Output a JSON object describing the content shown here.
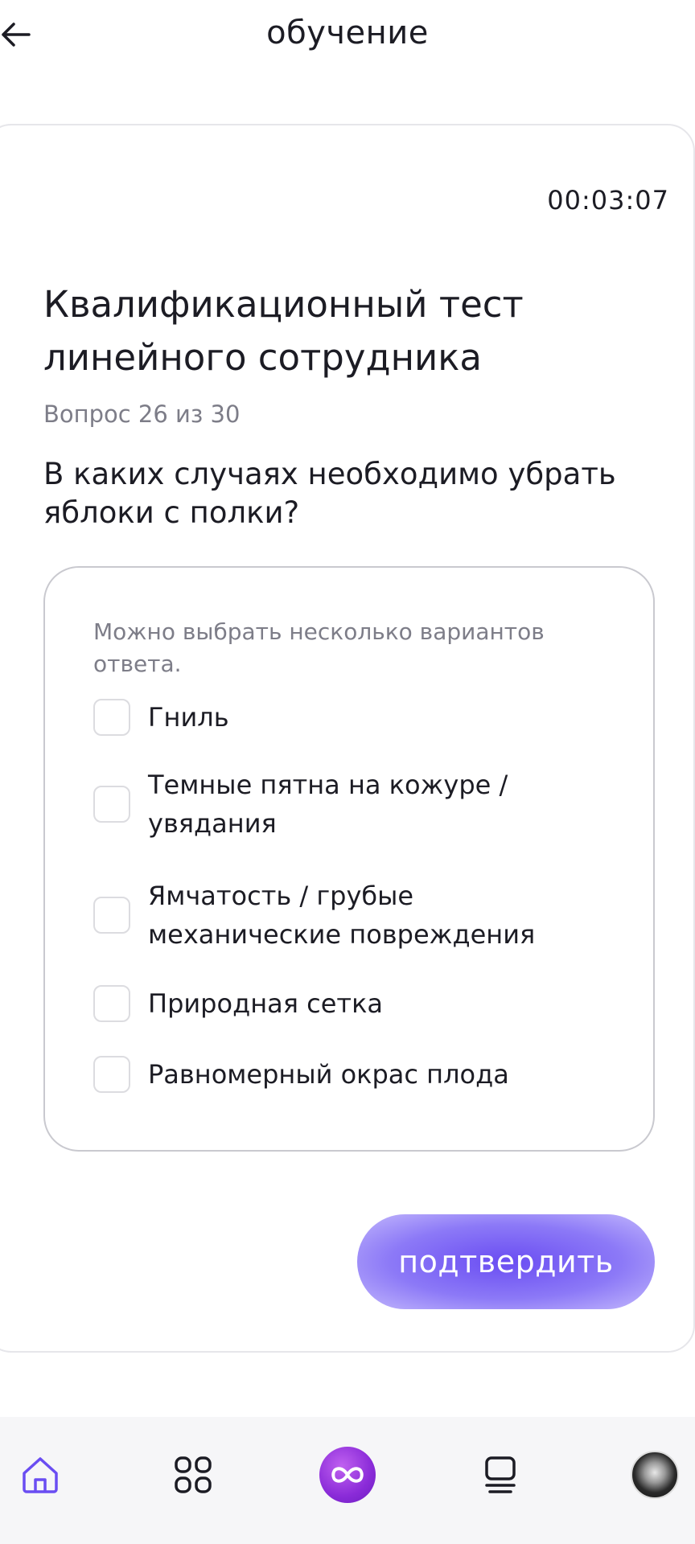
{
  "header": {
    "title": "обучение",
    "back_icon": "arrow-left-icon"
  },
  "test": {
    "timer": "00:03:07",
    "title": "Квалификационный тест линейного сотрудника",
    "progress": "Вопрос 26 из 30",
    "question": "В каких случаях необходимо убрать яблоки с полки?",
    "hint": "Можно выбрать несколько вариантов ответа.",
    "options": [
      {
        "label": "Гниль",
        "checked": false
      },
      {
        "label": "Темные пятна на кожуре / увядания",
        "checked": false
      },
      {
        "label": "Ямчатость / грубые механические повреждения",
        "checked": false
      },
      {
        "label": "Природная сетка",
        "checked": false
      },
      {
        "label": "Равномерный окрас плода",
        "checked": false
      }
    ],
    "confirm_label": "подтвердить"
  },
  "nav": {
    "items": [
      {
        "name": "home",
        "icon": "home-icon",
        "active": true
      },
      {
        "name": "catalog",
        "icon": "grid-icon",
        "active": false
      },
      {
        "name": "main",
        "icon": "infinity-icon",
        "active": false
      },
      {
        "name": "courses",
        "icon": "list-icon",
        "active": false
      },
      {
        "name": "profile",
        "icon": "avatar",
        "active": false
      }
    ]
  },
  "colors": {
    "accent": "#7b5cf5",
    "nav_active": "#6a4df2",
    "center_button": "#8a2bd8",
    "text": "#1c1c24",
    "secondary_text": "#7d7d88"
  }
}
